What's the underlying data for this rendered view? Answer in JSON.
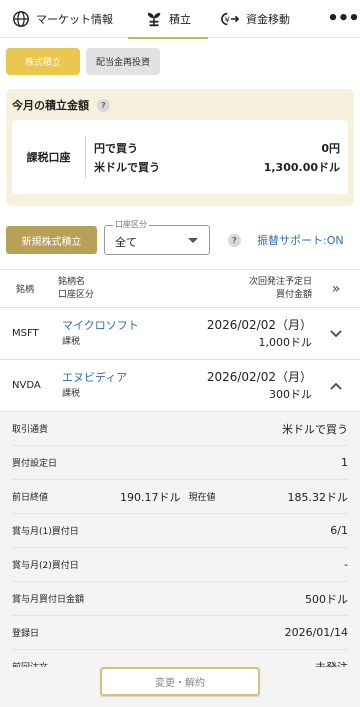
{
  "nav": {
    "market": "マーケット情報",
    "tsumitate": "積立",
    "transfer": "資金移動",
    "more": "•••"
  },
  "subtabs": [
    "株式積立",
    "配当金再投資"
  ],
  "monthly": {
    "title": "今月の積立金額",
    "help": "?",
    "account": "課税口座",
    "rows": [
      {
        "label": "円で買う",
        "value": "0円"
      },
      {
        "label": "米ドルで買う",
        "value": "1,300.00ドル"
      }
    ]
  },
  "controls": {
    "new_button": "新規株式積立",
    "select_legend": "口座区分",
    "select_value": "全て",
    "help": "?",
    "transfer_link": "振替サポート:ON"
  },
  "table_header": {
    "symbol": "銘柄",
    "name_line1": "銘柄名",
    "name_line2": "口座区分",
    "next_line1": "次回発注予定日",
    "next_line2": "買付金額",
    "expand": "»"
  },
  "rows": [
    {
      "symbol": "MSFT",
      "name": "マイクロソフト",
      "account": "課税",
      "date": "2026/02/02（月）",
      "amount": "1,000ドル"
    },
    {
      "symbol": "NVDA",
      "name": "エヌビディア",
      "account": "課税",
      "date": "2026/02/02（月）",
      "amount": "300ドル"
    }
  ],
  "detail": {
    "currency_label": "取引通貨",
    "currency_value": "米ドルで買う",
    "buyday_label": "買付設定日",
    "buyday_value": "1",
    "prevclose_label": "前日終値",
    "prevclose_value": "190.17ドル",
    "current_label": "現在値",
    "current_value": "185.32ドル",
    "bonus1_label": "賞与月(1)買付日",
    "bonus1_value": "6/1",
    "bonus2_label": "賞与月(2)買付日",
    "bonus2_value": "-",
    "bonusamt_label": "賞与月買付日金額",
    "bonusamt_value": "500ドル",
    "reg_label": "登録日",
    "reg_value": "2026/01/14",
    "prev_label": "前回注文",
    "prev_value": "未発注"
  },
  "footer": {
    "change_button": "変更・解約"
  },
  "colors": {
    "accent": "#e8c650",
    "button_gold": "#b8a157",
    "link": "#2f6fb5",
    "monthly_bg": "#f6f1de"
  }
}
